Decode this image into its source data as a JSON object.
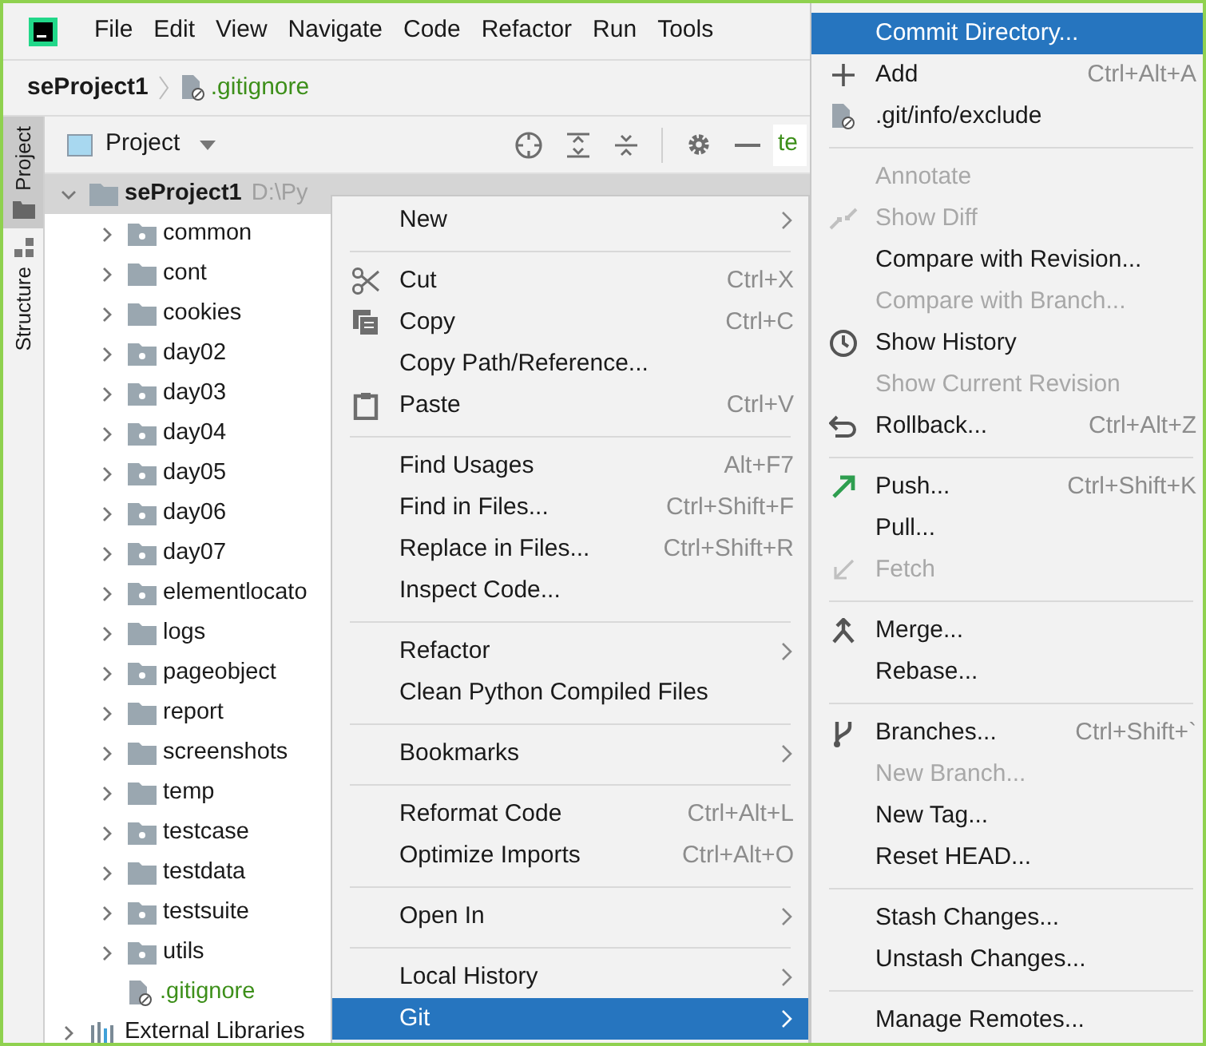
{
  "menu_bar": [
    {
      "label": "File"
    },
    {
      "label": "Edit"
    },
    {
      "label": "View"
    },
    {
      "label": "Navigate"
    },
    {
      "label": "Code"
    },
    {
      "label": "Refactor"
    },
    {
      "label": "Run"
    },
    {
      "label": "Tools"
    }
  ],
  "breadcrumb": {
    "project": "seProject1",
    "file": ".gitignore"
  },
  "tool_strip": [
    {
      "label": "Project",
      "selected": true
    },
    {
      "label": "Structure",
      "selected": false
    }
  ],
  "project_panel": {
    "view": "Project",
    "editor_tab": "te",
    "tree": [
      {
        "name": "seProject1",
        "path": "D:\\Py",
        "kind": "folder",
        "expanded": true,
        "selected": true,
        "children": [
          {
            "name": "common",
            "kind": "package",
            "expanded": false
          },
          {
            "name": "cont",
            "kind": "folder",
            "expanded": false
          },
          {
            "name": "cookies",
            "kind": "folder",
            "expanded": false
          },
          {
            "name": "day02",
            "kind": "package",
            "expanded": false
          },
          {
            "name": "day03",
            "kind": "package",
            "expanded": false
          },
          {
            "name": "day04",
            "kind": "package",
            "expanded": false
          },
          {
            "name": "day05",
            "kind": "package",
            "expanded": false
          },
          {
            "name": "day06",
            "kind": "package",
            "expanded": false
          },
          {
            "name": "day07",
            "kind": "package",
            "expanded": false
          },
          {
            "name": "elementlocato",
            "kind": "package",
            "expanded": false
          },
          {
            "name": "logs",
            "kind": "folder",
            "expanded": false
          },
          {
            "name": "pageobject",
            "kind": "package",
            "expanded": false
          },
          {
            "name": "report",
            "kind": "folder",
            "expanded": false
          },
          {
            "name": "screenshots",
            "kind": "folder",
            "expanded": false
          },
          {
            "name": "temp",
            "kind": "folder",
            "expanded": false
          },
          {
            "name": "testcase",
            "kind": "package",
            "expanded": false
          },
          {
            "name": "testdata",
            "kind": "folder",
            "expanded": false
          },
          {
            "name": "testsuite",
            "kind": "package",
            "expanded": false
          },
          {
            "name": "utils",
            "kind": "package",
            "expanded": false
          },
          {
            "name": ".gitignore",
            "kind": "file"
          }
        ]
      },
      {
        "name": "External Libraries",
        "kind": "library",
        "expanded": false
      }
    ]
  },
  "context_menu": [
    {
      "kind": "item",
      "label": "New",
      "submenu": true,
      "selected": false,
      "disabled": false
    },
    {
      "kind": "separator"
    },
    {
      "kind": "item",
      "label": "Cut",
      "shortcut": "Ctrl+X",
      "selected": false,
      "disabled": false
    },
    {
      "kind": "item",
      "label": "Copy",
      "shortcut": "Ctrl+C",
      "selected": false,
      "disabled": false
    },
    {
      "kind": "item",
      "label": "Copy Path/Reference...",
      "selected": false,
      "disabled": false
    },
    {
      "kind": "item",
      "label": "Paste",
      "shortcut": "Ctrl+V",
      "selected": false,
      "disabled": false
    },
    {
      "kind": "separator"
    },
    {
      "kind": "item",
      "label": "Find Usages",
      "shortcut": "Alt+F7",
      "selected": false,
      "disabled": false
    },
    {
      "kind": "item",
      "label": "Find in Files...",
      "shortcut": "Ctrl+Shift+F",
      "selected": false,
      "disabled": false
    },
    {
      "kind": "item",
      "label": "Replace in Files...",
      "shortcut": "Ctrl+Shift+R",
      "selected": false,
      "disabled": false
    },
    {
      "kind": "item",
      "label": "Inspect Code...",
      "selected": false,
      "disabled": false
    },
    {
      "kind": "separator"
    },
    {
      "kind": "item",
      "label": "Refactor",
      "submenu": true,
      "selected": false,
      "disabled": false
    },
    {
      "kind": "item",
      "label": "Clean Python Compiled Files",
      "selected": false,
      "disabled": false
    },
    {
      "kind": "separator"
    },
    {
      "kind": "item",
      "label": "Bookmarks",
      "submenu": true,
      "selected": false,
      "disabled": false
    },
    {
      "kind": "separator"
    },
    {
      "kind": "item",
      "label": "Reformat Code",
      "shortcut": "Ctrl+Alt+L",
      "selected": false,
      "disabled": false
    },
    {
      "kind": "item",
      "label": "Optimize Imports",
      "shortcut": "Ctrl+Alt+O",
      "selected": false,
      "disabled": false
    },
    {
      "kind": "separator"
    },
    {
      "kind": "item",
      "label": "Open In",
      "submenu": true,
      "selected": false,
      "disabled": false
    },
    {
      "kind": "separator"
    },
    {
      "kind": "item",
      "label": "Local History",
      "submenu": true,
      "selected": false,
      "disabled": false
    },
    {
      "kind": "item",
      "label": "Git",
      "submenu": true,
      "selected": true,
      "disabled": false
    }
  ],
  "git_submenu": [
    {
      "kind": "item",
      "label": "Commit Directory...",
      "selected": true,
      "disabled": false
    },
    {
      "kind": "item",
      "label": "Add",
      "shortcut": "Ctrl+Alt+A",
      "selected": false,
      "disabled": false
    },
    {
      "kind": "item",
      "label": ".git/info/exclude",
      "selected": false,
      "disabled": false
    },
    {
      "kind": "separator"
    },
    {
      "kind": "item",
      "label": "Annotate",
      "selected": false,
      "disabled": true
    },
    {
      "kind": "item",
      "label": "Show Diff",
      "selected": false,
      "disabled": true
    },
    {
      "kind": "item",
      "label": "Compare with Revision...",
      "selected": false,
      "disabled": false
    },
    {
      "kind": "item",
      "label": "Compare with Branch...",
      "selected": false,
      "disabled": true
    },
    {
      "kind": "item",
      "label": "Show History",
      "selected": false,
      "disabled": false
    },
    {
      "kind": "item",
      "label": "Show Current Revision",
      "selected": false,
      "disabled": true
    },
    {
      "kind": "item",
      "label": "Rollback...",
      "shortcut": "Ctrl+Alt+Z",
      "selected": false,
      "disabled": false
    },
    {
      "kind": "separator"
    },
    {
      "kind": "item",
      "label": "Push...",
      "shortcut": "Ctrl+Shift+K",
      "selected": false,
      "disabled": false
    },
    {
      "kind": "item",
      "label": "Pull...",
      "selected": false,
      "disabled": false
    },
    {
      "kind": "item",
      "label": "Fetch",
      "selected": false,
      "disabled": true
    },
    {
      "kind": "separator"
    },
    {
      "kind": "item",
      "label": "Merge...",
      "selected": false,
      "disabled": false
    },
    {
      "kind": "item",
      "label": "Rebase...",
      "selected": false,
      "disabled": false
    },
    {
      "kind": "separator"
    },
    {
      "kind": "item",
      "label": "Branches...",
      "shortcut": "Ctrl+Shift+`",
      "selected": false,
      "disabled": false
    },
    {
      "kind": "item",
      "label": "New Branch...",
      "selected": false,
      "disabled": true
    },
    {
      "kind": "item",
      "label": "New Tag...",
      "selected": false,
      "disabled": false
    },
    {
      "kind": "item",
      "label": "Reset HEAD...",
      "selected": false,
      "disabled": false
    },
    {
      "kind": "separator"
    },
    {
      "kind": "item",
      "label": "Stash Changes...",
      "selected": false,
      "disabled": false
    },
    {
      "kind": "item",
      "label": "Unstash Changes...",
      "selected": false,
      "disabled": false
    },
    {
      "kind": "separator"
    },
    {
      "kind": "item",
      "label": "Manage Remotes...",
      "selected": false,
      "disabled": false
    }
  ]
}
